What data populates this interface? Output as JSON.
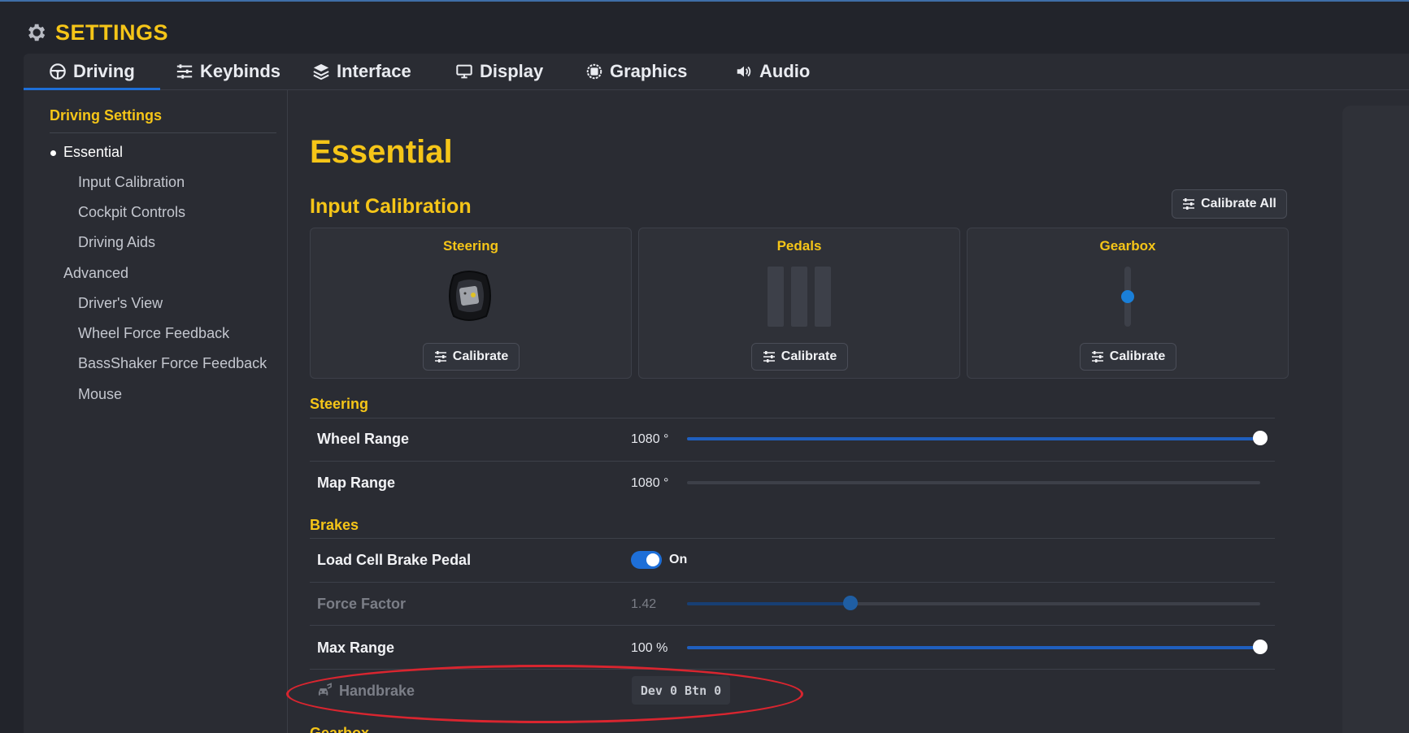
{
  "app": {
    "title": "SETTINGS",
    "title_icon": "gear-icon"
  },
  "colors": {
    "accent": "#f5c518",
    "primary": "#1e6fd8",
    "background": "#22242b",
    "panel": "#2a2c33",
    "highlight": "#d9252f"
  },
  "tabs": [
    {
      "label": "Driving",
      "icon": "steering-wheel-icon",
      "active": true
    },
    {
      "label": "Keybinds",
      "icon": "sliders-icon"
    },
    {
      "label": "Interface",
      "icon": "layers-icon"
    },
    {
      "label": "Display",
      "icon": "monitor-icon"
    },
    {
      "label": "Graphics",
      "icon": "chip-icon"
    },
    {
      "label": "Audio",
      "icon": "speaker-icon"
    }
  ],
  "sidebar": {
    "heading": "Driving Settings",
    "items": [
      {
        "label": "Essential",
        "current": true
      },
      {
        "label": "Input Calibration"
      },
      {
        "label": "Cockpit Controls"
      },
      {
        "label": "Driving Aids"
      },
      {
        "label": "Advanced"
      },
      {
        "label": "Driver's View"
      },
      {
        "label": "Wheel Force Feedback"
      },
      {
        "label": "BassShaker Force Feedback"
      },
      {
        "label": "Mouse"
      }
    ]
  },
  "main": {
    "title": "Essential",
    "input_calibration": {
      "heading": "Input Calibration",
      "calibrate_all_label": "Calibrate All",
      "cards": [
        {
          "title": "Steering",
          "button": "Calibrate"
        },
        {
          "title": "Pedals",
          "button": "Calibrate"
        },
        {
          "title": "Gearbox",
          "button": "Calibrate"
        }
      ]
    },
    "steering": {
      "heading": "Steering",
      "wheel_range": {
        "label": "Wheel Range",
        "value": "1080 °",
        "fraction": 1.0
      },
      "map_range": {
        "label": "Map Range",
        "value": "1080 °",
        "fraction": 0.0
      }
    },
    "brakes": {
      "heading": "Brakes",
      "load_cell": {
        "label": "Load Cell Brake Pedal",
        "state": "On"
      },
      "force_factor": {
        "label": "Force Factor",
        "value": "1.42",
        "fraction": 0.285
      },
      "max_range": {
        "label": "Max Range",
        "value": "100 %",
        "fraction": 1.0
      },
      "handbrake": {
        "label": "Handbrake",
        "binding": "Dev 0 Btn 0",
        "icon": "handbrake-icon"
      }
    },
    "gearbox_heading": "Gearbox"
  }
}
